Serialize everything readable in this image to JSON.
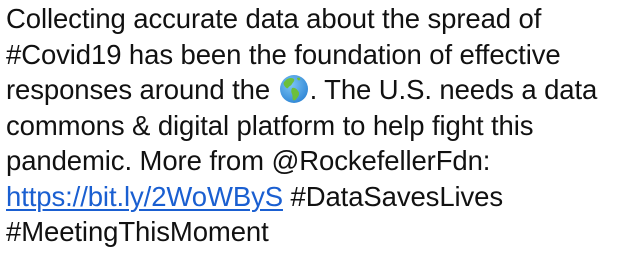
{
  "tweet": {
    "line1": "Collecting accurate data about the spread of",
    "line2": "#Covid19 has been the foundation of effective",
    "line3_before_emoji": "responses around the ",
    "emoji": "globe-earth-americas-icon",
    "line3_after_emoji": ". The U.S. needs a data",
    "line4": "commons & digital platform to help fight this",
    "line5": "pandemic. More from @RockefellerFdn:",
    "link_text": "https://bit.ly/2WoWByS",
    "line6_after_link": " #DataSavesLives",
    "line7": "#MeetingThisMoment"
  },
  "colors": {
    "text": "#111111",
    "link": "#1a5fd1",
    "ocean": "#4aa3e8",
    "land": "#6cbf3a"
  }
}
